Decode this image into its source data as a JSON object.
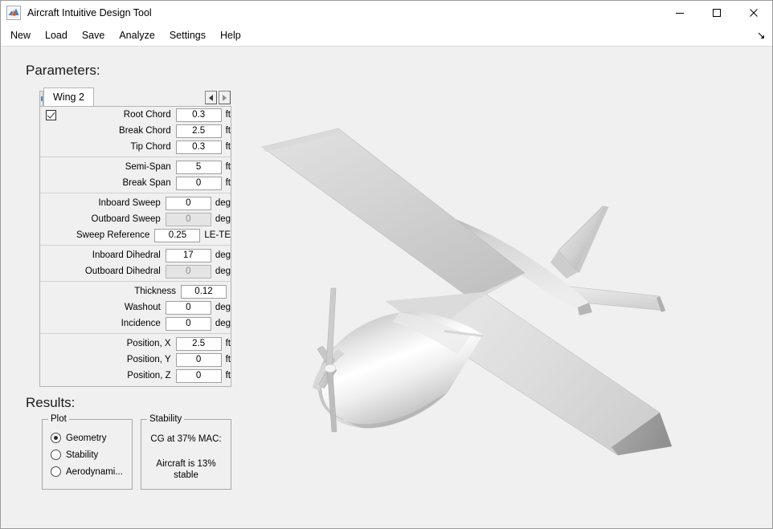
{
  "window": {
    "title": "Aircraft Intuitive Design Tool",
    "icon": "matlab-membrane-icon",
    "controls": {
      "minimize": "minimize-icon",
      "maximize": "maximize-icon",
      "close": "close-icon"
    }
  },
  "menubar": {
    "items": [
      {
        "label": "New"
      },
      {
        "label": "Load"
      },
      {
        "label": "Save"
      },
      {
        "label": "Analyze"
      },
      {
        "label": "Settings"
      },
      {
        "label": "Help"
      }
    ],
    "expander_icon": "arrow-corner-icon"
  },
  "sections": {
    "parameters_heading": "Parameters:",
    "results_heading": "Results:"
  },
  "parameters_panel": {
    "active_tab": "Wing 2",
    "scroll_left_icon": "triangle-left-icon",
    "scroll_right_icon": "triangle-right-icon",
    "enable_checkbox_checked": true,
    "groups": [
      {
        "rows": [
          {
            "label": "Root Chord",
            "value": "0.3",
            "unit": "ft",
            "disabled": false,
            "has_checkbox": true
          },
          {
            "label": "Break Chord",
            "value": "2.5",
            "unit": "ft",
            "disabled": false,
            "has_checkbox": false
          },
          {
            "label": "Tip Chord",
            "value": "0.3",
            "unit": "ft",
            "disabled": false,
            "has_checkbox": false
          }
        ]
      },
      {
        "rows": [
          {
            "label": "Semi-Span",
            "value": "5",
            "unit": "ft",
            "disabled": false,
            "has_checkbox": false
          },
          {
            "label": "Break Span",
            "value": "0",
            "unit": "ft",
            "disabled": false,
            "has_checkbox": false
          }
        ]
      },
      {
        "rows": [
          {
            "label": "Inboard Sweep",
            "value": "0",
            "unit": "deg",
            "disabled": false,
            "has_checkbox": false
          },
          {
            "label": "Outboard Sweep",
            "value": "0",
            "unit": "deg",
            "disabled": true,
            "has_checkbox": false
          },
          {
            "label": "Sweep Reference",
            "value": "0.25",
            "unit": "LE-TE",
            "disabled": false,
            "has_checkbox": false
          }
        ]
      },
      {
        "rows": [
          {
            "label": "Inboard Dihedral",
            "value": "17",
            "unit": "deg",
            "disabled": false,
            "has_checkbox": false
          },
          {
            "label": "Outboard Dihedral",
            "value": "0",
            "unit": "deg",
            "disabled": true,
            "has_checkbox": false
          }
        ]
      },
      {
        "rows": [
          {
            "label": "Thickness",
            "value": "0.12",
            "unit": "",
            "disabled": false,
            "has_checkbox": false
          },
          {
            "label": "Washout",
            "value": "0",
            "unit": "deg",
            "disabled": false,
            "has_checkbox": false
          },
          {
            "label": "Incidence",
            "value": "0",
            "unit": "deg",
            "disabled": false,
            "has_checkbox": false
          }
        ]
      },
      {
        "rows": [
          {
            "label": "Position, X",
            "value": "2.5",
            "unit": "ft",
            "disabled": false,
            "has_checkbox": false
          },
          {
            "label": "Position, Y",
            "value": "0",
            "unit": "ft",
            "disabled": false,
            "has_checkbox": false
          },
          {
            "label": "Position, Z",
            "value": "0",
            "unit": "ft",
            "disabled": false,
            "has_checkbox": false
          }
        ]
      }
    ]
  },
  "results": {
    "plot_group": {
      "title": "Plot",
      "options": [
        {
          "label": "Geometry",
          "selected": true
        },
        {
          "label": "Stability",
          "selected": false
        },
        {
          "label": "Aerodynami...",
          "selected": false
        }
      ]
    },
    "stability_group": {
      "title": "Stability",
      "line1": "CG at 37% MAC:",
      "line2": "Aircraft is 13%",
      "line3": "stable"
    }
  },
  "viewport": {
    "name": "aircraft-3d-geometry",
    "description": "Shaded 3D rendering of a high-wing single-propeller light aircraft",
    "background_color": "#f0f0f0",
    "surface_light": "#f2f2f2",
    "surface_mid": "#d6d6d6",
    "surface_dark": "#9a9a9a"
  }
}
